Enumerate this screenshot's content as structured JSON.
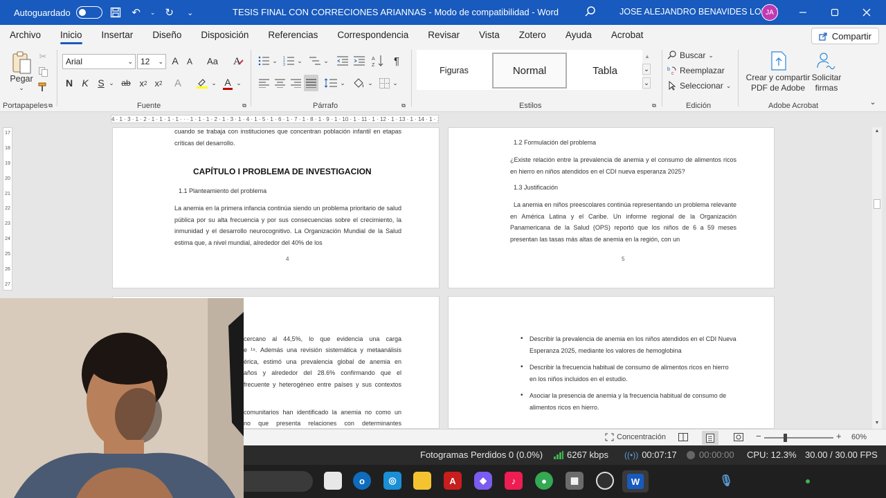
{
  "titlebar": {
    "autosave_label": "Autoguardado",
    "autosave_state": "off",
    "document_title": "TESIS FINAL CON CORRECIONES ARIANNAS  -  Modo de compatibilidad  -  Word",
    "user_name": "JOSE ALEJANDRO BENAVIDES LOPEZ",
    "user_initials": "JA",
    "accent_color": "#185abd",
    "avatar_color": "#c239b3"
  },
  "menu": {
    "tabs": [
      "Archivo",
      "Inicio",
      "Insertar",
      "Diseño",
      "Disposición",
      "Referencias",
      "Correspondencia",
      "Revisar",
      "Vista",
      "Zotero",
      "Ayuda",
      "Acrobat"
    ],
    "active_tab": "Inicio",
    "share_label": "Compartir"
  },
  "ribbon": {
    "clipboard": {
      "paste_label": "Pegar",
      "group_label": "Portapapeles"
    },
    "font": {
      "font_name": "Arial",
      "font_size": "12",
      "size_up": "A",
      "size_down": "A",
      "case_label": "Aa",
      "bold": "N",
      "italic": "K",
      "underline": "S",
      "strike": "ab",
      "subscript": "x",
      "superscript": "x",
      "effects": "A",
      "font_color_letter": "A",
      "group_label": "Fuente"
    },
    "paragraph": {
      "group_label": "Párrafo",
      "pilcrow": "¶"
    },
    "styles": {
      "items": [
        "Figuras",
        "Normal",
        "Tabla"
      ],
      "selected": "Normal",
      "group_label": "Estilos"
    },
    "editing": {
      "find_label": "Buscar",
      "replace_label": "Reemplazar",
      "select_label": "Seleccionar",
      "group_label": "Edición"
    },
    "acrobat": {
      "create_label_1": "Crear y compartir",
      "create_label_2": "PDF de Adobe",
      "sign_label_1": "Solicitar",
      "sign_label_2": "firmas",
      "group_label": "Adobe Acrobat"
    }
  },
  "ruler": {
    "horizontal": "4 · 1 · 3 · 1 · 2 · 1 · 1 · 1 · 1 · · · 1 · 1 · 1 · 2 · 1 · 3 · 1 · 4 · 1 · 5 · 1 · 6 · 1 · 7 · 1 · 8 · 1 · 9 · 1 · 10 · 1 · 11 · 1 · 12 · 1 · 13 · 1 · 14 · 1 · 15 · 1 · 16 · 1 ·",
    "vertical": [
      "17",
      "18",
      "19",
      "20",
      "21",
      "22",
      "23",
      "24",
      "25",
      "26",
      "27"
    ]
  },
  "pages": {
    "p4": {
      "top_text": "cuando se trabaja con instituciones que concentran población infantil en etapas críticas del desarrollo.",
      "chapter_title": "CAPÍTULO I PROBLEMA DE INVESTIGACION",
      "section": "1.1 Planteamiento del problema",
      "body": "La anemia en la primera infancia continúa siendo un problema prioritario de salud pública por su alta frecuencia y por sus consecuencias sobre el crecimiento, la inmunidad y el desarrollo neurocognitivo. La Organización Mundial de la Salud estima que, a nivel mundial, alrededor del 40% de los",
      "page_number": "4"
    },
    "p5": {
      "section_a": "1.2 Formulación del problema",
      "question": "¿Existe relación entre la prevalencia de anemia y el consumo de alimentos ricos en hierro en niños atendidos en el CDI nueva esperanza 2025?",
      "section_b": "1.3 Justificación",
      "body": "La anemia en niños preescolares continúa representando un problema relevante en América Latina y el Caribe. Un informe regional de la Organización Panamericana de la Salud (OPS) reportó que los niños de 6 a 59 meses presentan las tasas más altas de anemia en la región, con un",
      "page_number": "5"
    },
    "p6": {
      "line1": "cercano al 44,5%, lo que evidencia una carga",
      "line2": "e ¹⁸. Además una revisión sistemática y metaanálisis",
      "line3": "érica, estimó una prevalencia global de anemia en",
      "line4": "años y alrededor del 28.6% confirmando que el",
      "line5": "frecuente y heterogéneo entre países y sus contextos",
      "line6": "comunitarios han identificado la anemia no como un",
      "line7": "no que presenta relaciones con determinantes"
    },
    "p7": {
      "bullets": [
        "Describir la prevalencia de anemia en los niños atendidos en el CDI Nueva Esperanza 2025, mediante los valores de hemoglobina",
        "Describir la frecuencia habitual de consumo de alimentos ricos en hierro en los niños incluidos en el estudio.",
        "Asociar la presencia de anemia y la frecuencia habitual de consumo de alimentos ricos en hierro."
      ]
    }
  },
  "statusbar": {
    "focus_label": "Concentración",
    "zoom": "60%"
  },
  "recording": {
    "dropped_frames": "Fotogramas Perdidos 0 (0.0%)",
    "bitrate": "6267 kbps",
    "stream_time": "00:07:17",
    "rec_time": "00:00:00",
    "cpu": "CPU: 12.3%",
    "fps": "30.00 / 30.00 FPS"
  },
  "taskbar": {
    "apps": [
      "file-explorer",
      "outlook",
      "store",
      "folder",
      "acrobat",
      "copilot",
      "tiktok",
      "chrome",
      "calculator",
      "obs",
      "word"
    ]
  }
}
